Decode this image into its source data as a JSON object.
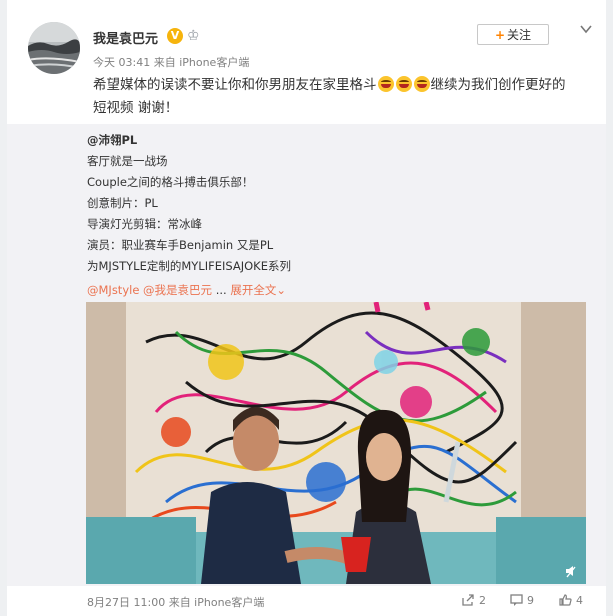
{
  "post": {
    "username": "我是袁巴元",
    "verified_badge": "V",
    "meta": "今天 03:41 来自 iPhone客户端",
    "follow_label": "关注",
    "text_part1": "希望媒体的误读不要让你和你男朋友在家里格斗",
    "text_part2": "继续为我们创作更好的",
    "text_line2": "短视频 谢谢！",
    "emoji_count": 3
  },
  "repost": {
    "author": "@沛翎PL",
    "lines": [
      "客厅就是一战场",
      "Couple之间的格斗搏击俱乐部！",
      "创意制片：PL",
      "导演灯光剪辑：常冰峰",
      "演员：职业赛车手Benjamin 又是PL",
      "为MJSTYLE定制的MYLIFEISAJOKE系列"
    ],
    "mention1": "@MJstyle",
    "mention2": "@我是袁巴元",
    "ellipsis": "...",
    "expand": "展开全文",
    "expand_arrow": "⌄",
    "footer_time": "8月27日 11:00 来自 iPhone客户端",
    "repost_count": "2",
    "comment_count": "9",
    "like_count": "4"
  },
  "icons": [
    "chevron-down-icon",
    "share-icon",
    "comment-icon",
    "like-icon",
    "sound-icon"
  ],
  "colors": {
    "link": "#eb7350",
    "accent": "#ff8200",
    "verified": "#f6b40d",
    "muted": "#808080"
  }
}
